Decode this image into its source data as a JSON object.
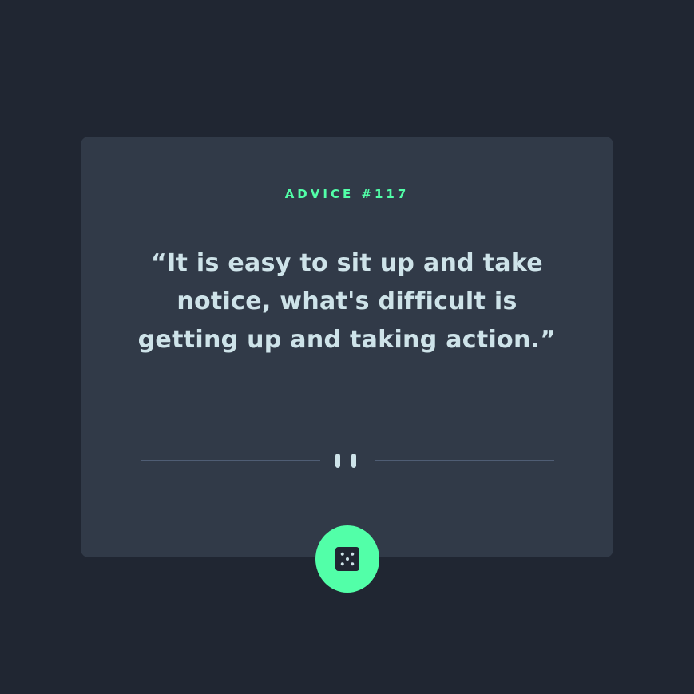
{
  "advice": {
    "id_label": "ADVICE #117",
    "quote": "“It is easy to sit up and take notice, what's difficult is getting up and taking action.”"
  },
  "icons": {
    "divider": "pause-icon",
    "generate": "dice-icon"
  },
  "colors": {
    "background": "#202632",
    "card": "#313a48",
    "accent": "#52ffa8",
    "text": "#cee3e9",
    "divider": "#4f5d74"
  }
}
